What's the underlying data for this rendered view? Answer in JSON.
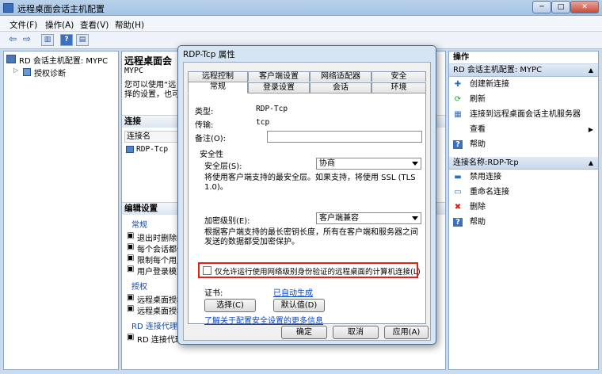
{
  "window": {
    "title": "远程桌面会话主机配置",
    "buttons": {
      "minimize": "─",
      "maximize": "□",
      "close": "✕"
    }
  },
  "menu": [
    "文件(F)",
    "操作(A)",
    "查看(V)",
    "帮助(H)"
  ],
  "tree": {
    "root": "RD 会话主机配置: MYPC",
    "child": "授权诊断"
  },
  "middle": {
    "title": "远程桌面会",
    "subtitle": "MYPC",
    "desc1": "您可以使用“远",
    "desc2": "择的设置，也可",
    "connections_header": "连接",
    "col_name": "连接名",
    "conn_row": "RDP-Tcp",
    "edit_header": "编辑设置",
    "group_general": "常规",
    "general_items": [
      "退出时删除临",
      "每个会话都使",
      "限制每个用户",
      "用户登录模式"
    ],
    "group_license": "授权",
    "license_items": [
      "远程桌面授权",
      "远程桌面授权"
    ],
    "group_rdbroker": "RD 连接代理",
    "rdbroker_items": [
      "RD 连接代理"
    ]
  },
  "actions": {
    "header": "操作",
    "section1": "RD 会话主机配置: MYPC",
    "items1": [
      "创建新连接",
      "刷新",
      "连接到远程桌面会话主机服务器",
      "查看",
      "帮助"
    ],
    "section2": "连接名称:RDP-Tcp",
    "items2": [
      "禁用连接",
      "重命名连接",
      "删除",
      "帮助"
    ]
  },
  "dialog": {
    "title": "RDP-Tcp 属性",
    "tabs_row1": [
      "远程控制",
      "客户端设置",
      "网络适配器",
      "安全"
    ],
    "tabs_row2": [
      "常规",
      "登录设置",
      "会话",
      "环境"
    ],
    "type_label": "类型:",
    "type_value": "RDP-Tcp",
    "transport_label": "传输:",
    "transport_value": "tcp",
    "comment_label": "备注(O):",
    "comment_value": "",
    "security_group": "安全性",
    "security_layer_label": "安全层(S):",
    "security_layer_value": "协商",
    "security_desc": "将使用客户端支持的最安全层。如果支持，将使用 SSL (TLS 1.0)。",
    "encryption_label": "加密级别(E):",
    "encryption_value": "客户端兼容",
    "encryption_desc": "根据客户端支持的最长密钥长度，所有在客户端和服务器之间发送的数据都受加密保护。",
    "nla_checkbox": "仅允许运行使用网络级别身份验证的远程桌面的计算机连接(L)",
    "cert_label": "证书:",
    "cert_value": "已自动生成",
    "select_button": "选择(C)",
    "default_button": "默认值(D)",
    "more_info_link": "了解关于配置安全设置的更多信息",
    "ok": "确定",
    "cancel": "取消",
    "apply": "应用(A)"
  }
}
